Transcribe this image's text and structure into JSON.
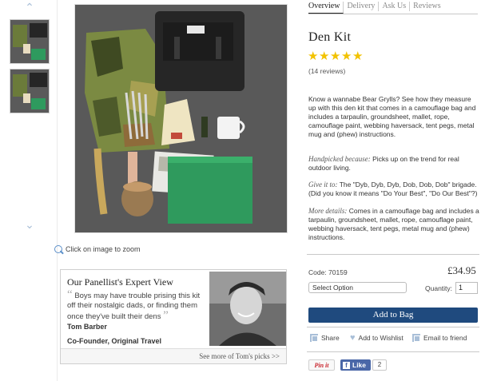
{
  "gallery": {
    "zoom_hint": "Click on image to zoom"
  },
  "panellist": {
    "title": "Our Panellist's Expert View",
    "quote": "Boys may have trouble prising this kit off their nostalgic dads, or finding them once they've built their dens",
    "name": "Tom Barber",
    "role": "Co-Founder, Original Travel",
    "footer_link": "See more of Tom's picks"
  },
  "tabs": [
    "Overview",
    "Delivery",
    "Ask Us",
    "Reviews"
  ],
  "product": {
    "title": "Den Kit",
    "rating": 5,
    "review_count": "(14 reviews)",
    "description": "Know a wannabe Bear Grylls? See how they measure up with this den kit that comes in a camouflage bag and includes a tarpaulin, groundsheet, mallet, rope, camouflage paint, webbing haversack, tent pegs, metal mug and (phew) instructions.",
    "handpicked_label": "Handpicked because:",
    "handpicked_text": " Picks up on the trend for real outdoor living.",
    "give_label": "Give it to:",
    "give_text": " The \"Dyb, Dyb, Dyb, Dob, Dob, Dob\" brigade. (Did you know it means \"Do Your Best\", \"Do Our Best\"?)",
    "details_label": "More details:",
    "details_text": " Comes in a camouflage bag and includes a tarpaulin, groundsheet, mallet, rope, camouflage paint, webbing haversack, tent pegs, metal mug and (phew) instructions.",
    "code": "Code: 70159",
    "price": "£34.95",
    "select_placeholder": "Select Option",
    "quantity_label": "Quantity:",
    "quantity_value": "1",
    "add_to_bag": "Add to Bag"
  },
  "actions": {
    "share": "Share",
    "wishlist": "Add to Wishlist",
    "email": "Email to friend"
  },
  "social": {
    "pinit": "Pin it",
    "like": "Like",
    "like_count": "2"
  },
  "colors": {
    "accent": "#1f4a7e",
    "star": "#f2c200",
    "icon": "#a9bfd8"
  }
}
